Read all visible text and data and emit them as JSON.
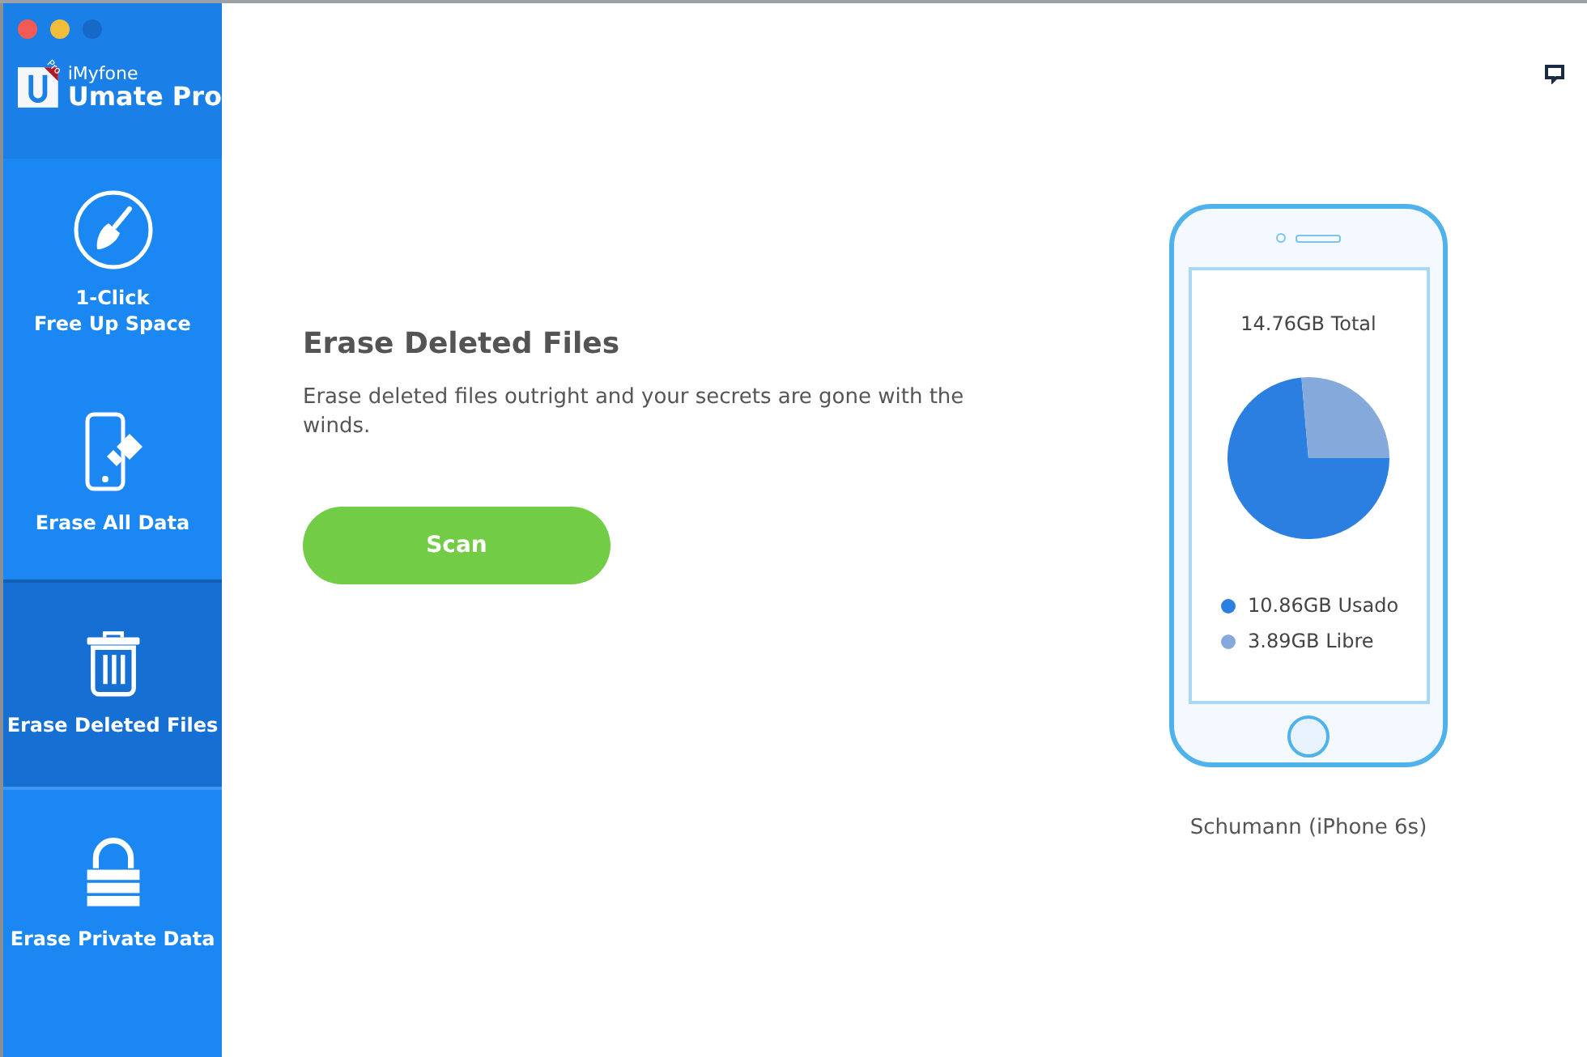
{
  "app": {
    "brand": "iMyfone",
    "product": "Umate Pro",
    "badge": "Pro"
  },
  "sidebar": {
    "items": [
      {
        "label": "1-Click\nFree Up Space",
        "selected": false
      },
      {
        "label": "Erase All Data",
        "selected": false
      },
      {
        "label": "Erase Deleted Files",
        "selected": true
      },
      {
        "label": "Erase Private Data",
        "selected": false
      }
    ]
  },
  "main": {
    "title": "Erase Deleted Files",
    "description": "Erase deleted files outright and your secrets are gone with the winds.",
    "button": "Scan"
  },
  "device": {
    "total": "14.76GB Total",
    "name": "Schumann (iPhone 6s)",
    "legend": [
      {
        "color": "#2b7fe0"
      },
      {
        "color": "#86a9dc"
      }
    ],
    "chart_data": {
      "type": "pie",
      "categories": [
        "10.86GB Usado",
        "3.89GB Libre"
      ],
      "values": [
        10.86,
        3.89
      ]
    }
  }
}
